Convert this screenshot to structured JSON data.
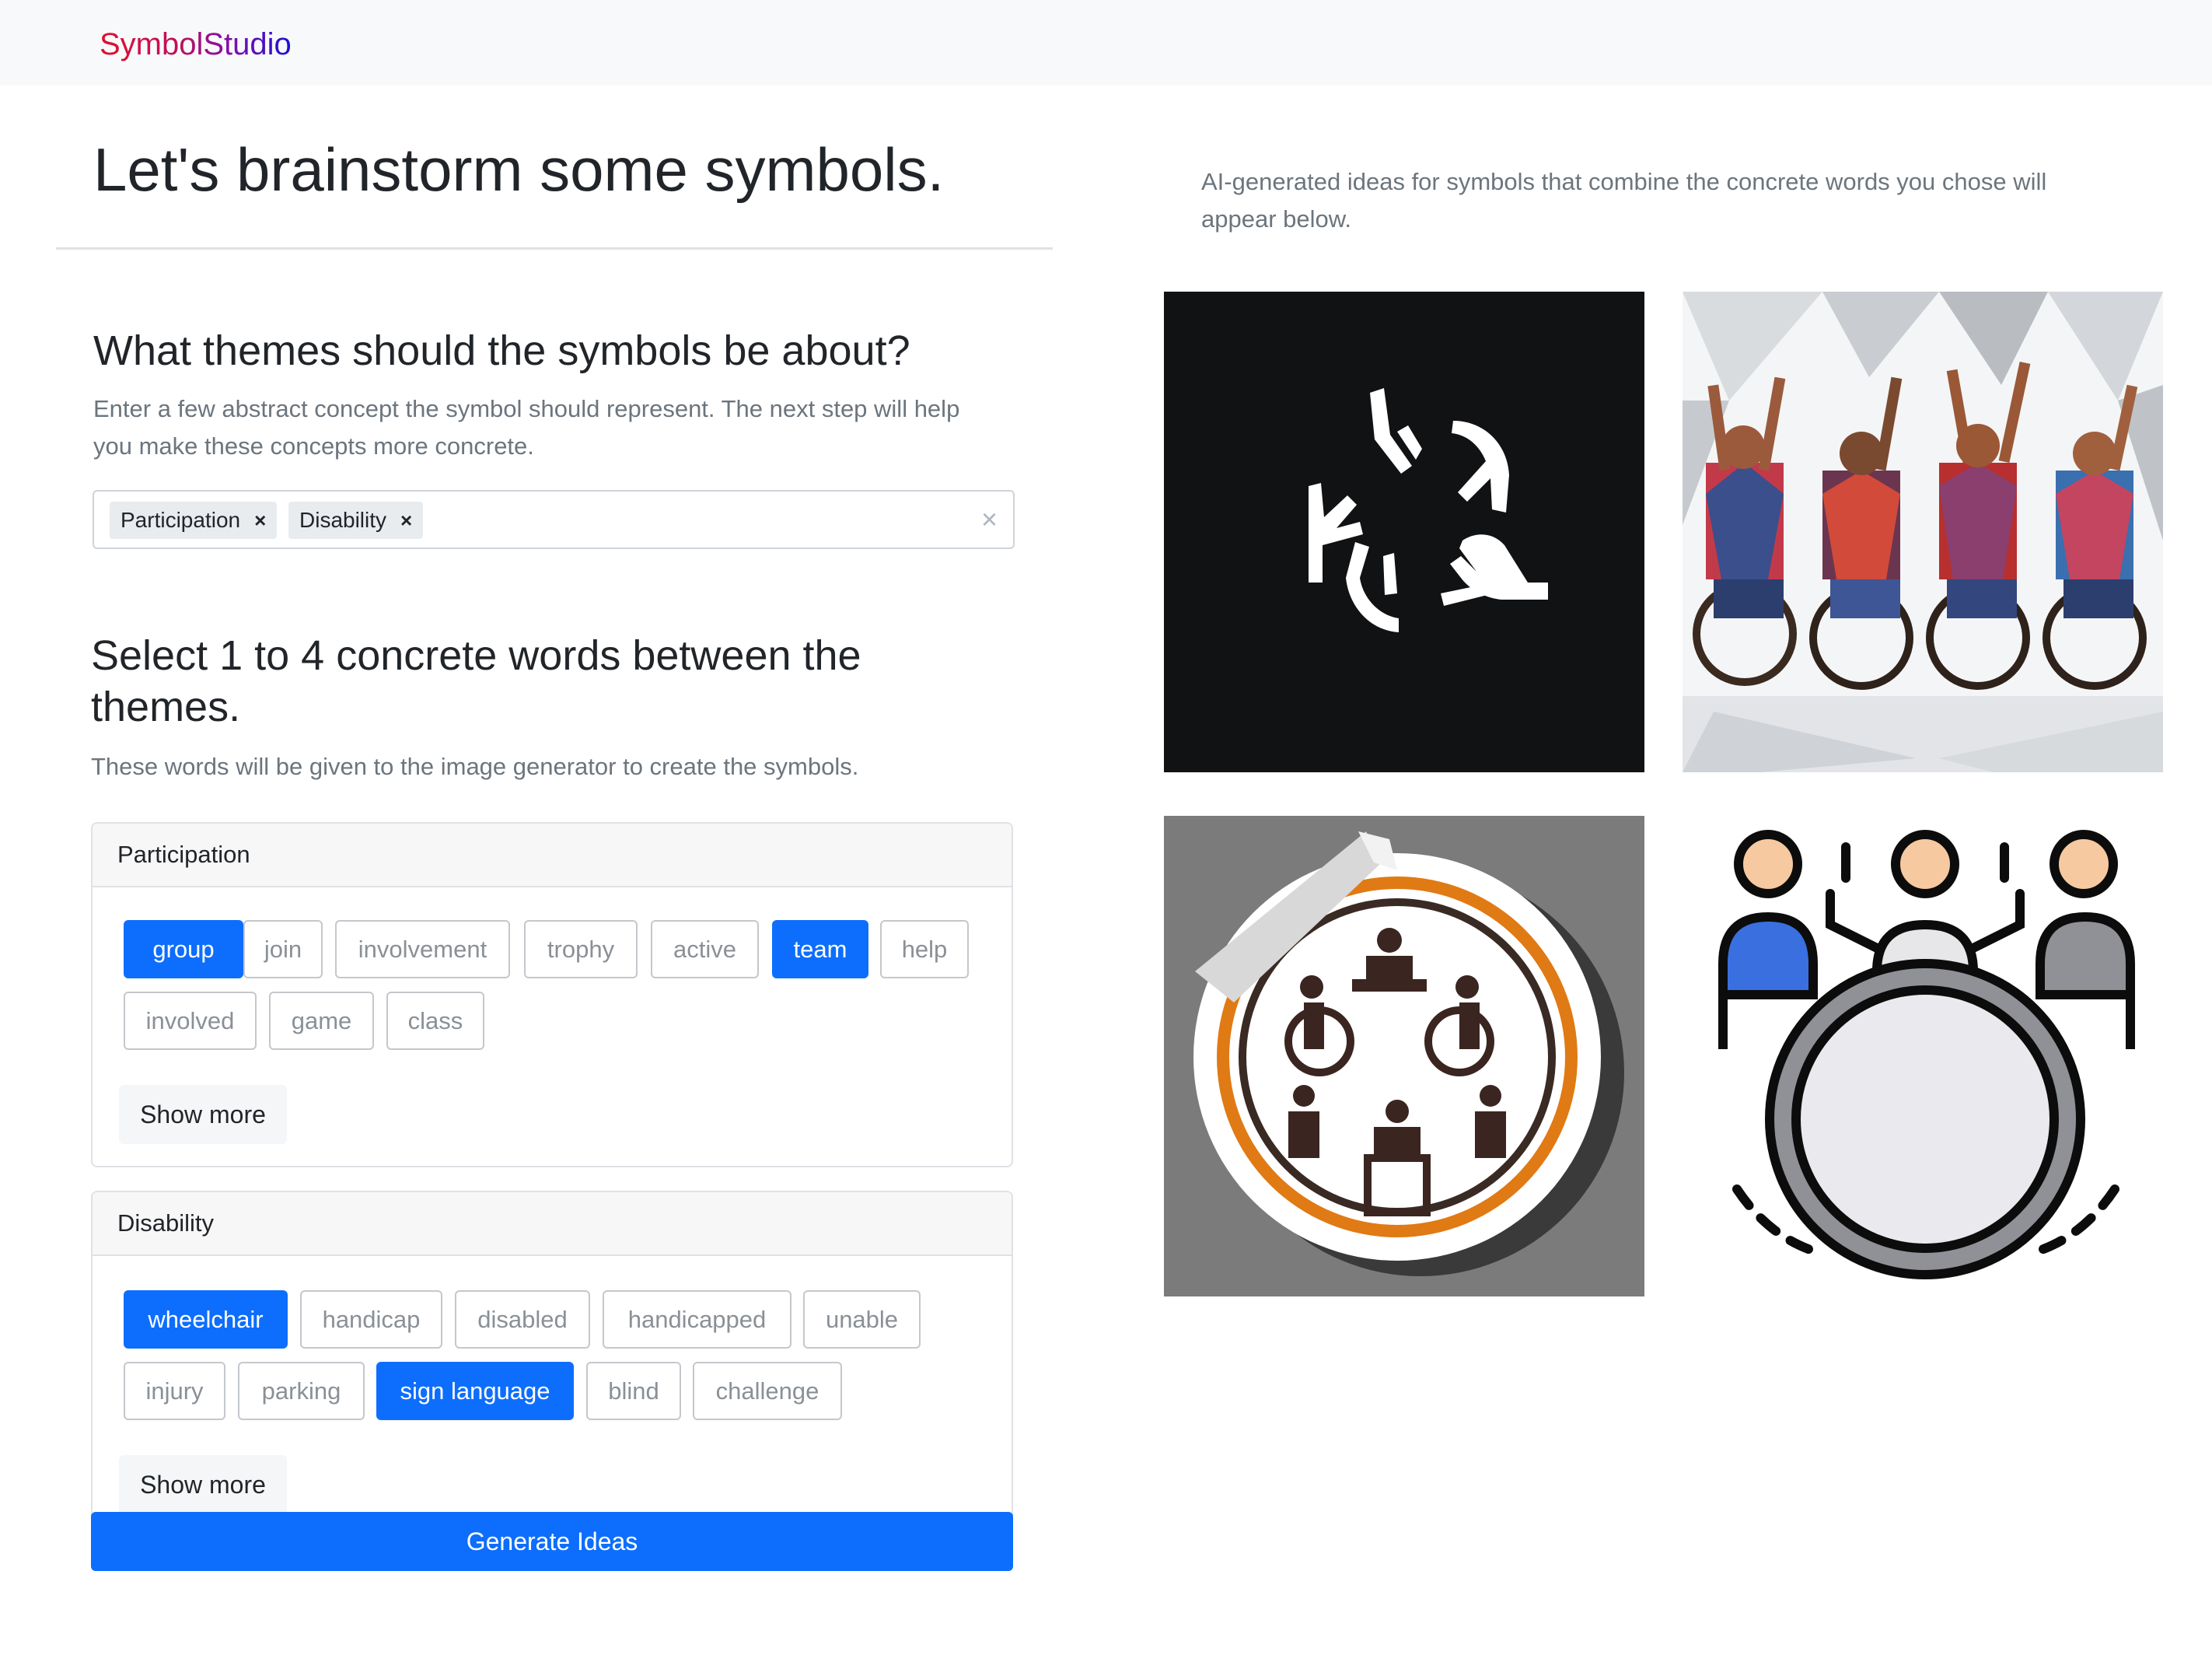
{
  "navbar": {
    "brand": "SymbolStudio"
  },
  "main": {
    "title": "Let's brainstorm some symbols.",
    "themes": {
      "heading": "What themes should the symbols be about?",
      "description_line1": "Enter a few abstract concept the symbol should represent. The next step will help",
      "description_line2": "you make these concepts more concrete.",
      "tags": [
        "Participation",
        "Disability"
      ],
      "tag_remove": "×",
      "clear_all": "×"
    },
    "words": {
      "heading_line1": "Select 1 to 4 concrete words between the",
      "heading_line2": "themes.",
      "description": "These words will be given to the image generator to create the symbols."
    },
    "cards": [
      {
        "title": "Participation",
        "chips": [
          {
            "label": "group",
            "selected": true
          },
          {
            "label": "join",
            "selected": false
          },
          {
            "label": "involvement",
            "selected": false
          },
          {
            "label": "trophy",
            "selected": false
          },
          {
            "label": "active",
            "selected": false
          },
          {
            "label": "team",
            "selected": true
          },
          {
            "label": "help",
            "selected": false
          },
          {
            "label": "involved",
            "selected": false
          },
          {
            "label": "game",
            "selected": false
          },
          {
            "label": "class",
            "selected": false
          }
        ],
        "show_more": "Show more"
      },
      {
        "title": "Disability",
        "chips": [
          {
            "label": "wheelchair",
            "selected": true
          },
          {
            "label": "handicap",
            "selected": false
          },
          {
            "label": "disabled",
            "selected": false
          },
          {
            "label": "handicapped",
            "selected": false
          },
          {
            "label": "unable",
            "selected": false
          },
          {
            "label": "injury",
            "selected": false
          },
          {
            "label": "parking",
            "selected": false
          },
          {
            "label": "sign language",
            "selected": true
          },
          {
            "label": "blind",
            "selected": false
          },
          {
            "label": "challenge",
            "selected": false
          }
        ],
        "show_more": "Show more"
      }
    ],
    "generate_button": "Generate Ideas"
  },
  "results": {
    "description_line1": "AI-generated ideas for symbols that combine the concrete words you chose will",
    "description_line2": "appear below.",
    "images": [
      "hands-circle-image",
      "wheelchair-athletes-image",
      "wheelchair-sticker-image",
      "team-wheel-icon-image"
    ]
  },
  "colors": {
    "primary": "#0d6efd",
    "muted": "#6c757d",
    "navbar_bg": "#f8f9fa",
    "brand_gradient": [
      "#e0102e",
      "#1a10d8"
    ]
  }
}
